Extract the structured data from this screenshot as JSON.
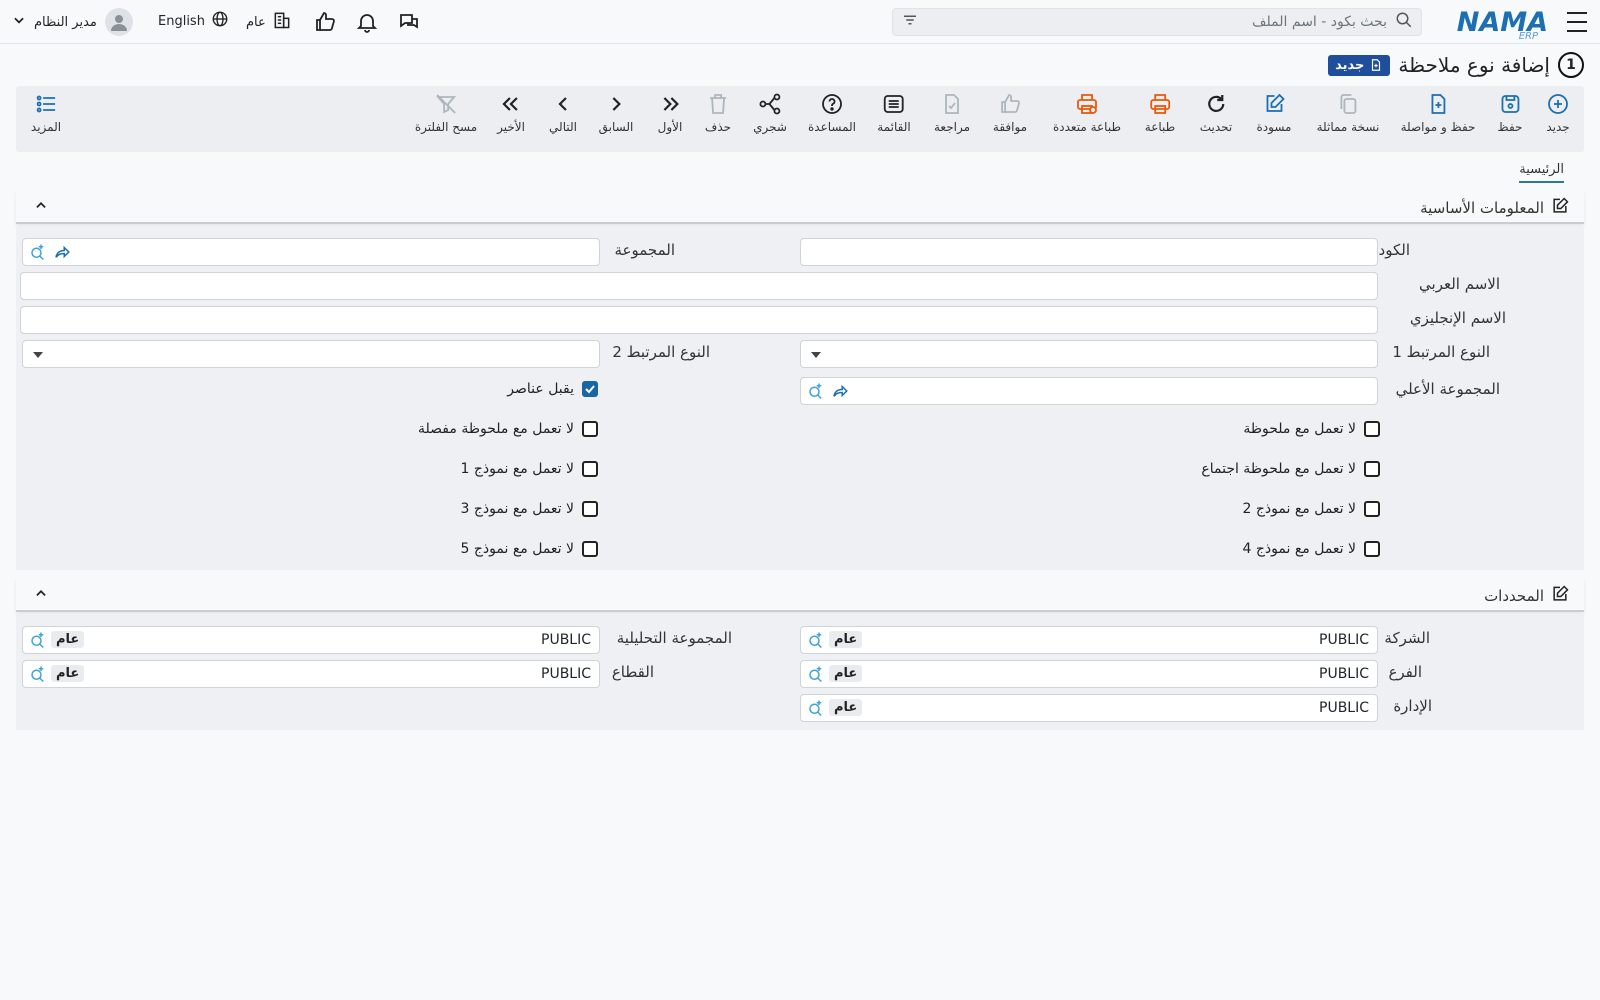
{
  "topbar": {
    "logo_text": "NAMA",
    "logo_sub": "ERP",
    "search_placeholder": "بحث بكود - اسم الملف",
    "company_label": "عام",
    "language_label": "English",
    "user_name": "مدير النظام"
  },
  "title": {
    "number": "1",
    "text": "إضافة نوع ملاحظة",
    "badge": "جديد"
  },
  "toolbar": {
    "new": "جديد",
    "save": "حفظ",
    "save_continue": "حفظ و مواصلة",
    "duplicate": "نسخة مماثلة",
    "draft": "مسودة",
    "refresh": "تحديث",
    "print": "طباعة",
    "multi_print": "طباعة متعددة",
    "approve": "موافقة",
    "review": "مراجعة",
    "list": "القائمة",
    "help": "المساعدة",
    "tree": "شجري",
    "delete": "حذف",
    "first": "الأول",
    "previous": "السابق",
    "next": "التالي",
    "last": "الأخير",
    "clear_filter": "مسح الفلترة",
    "more": "المزيد"
  },
  "tabs": {
    "main": "الرئيسية"
  },
  "basic": {
    "title": "المعلومات الأساسية",
    "code_label": "الكود",
    "group_label": "المجموعة",
    "arabic_name_label": "الاسم العربي",
    "english_name_label": "الاسم الإنجليزي",
    "related1_label": "النوع المرتبط 1",
    "related2_label": "النوع المرتبط 2",
    "parent_group_label": "المجموعة الأعلي",
    "accepts_items": "يقبل عناصر",
    "checkboxes": {
      "not_with_note": "لا تعمل مع ملحوظة",
      "not_with_detailed_note": "لا تعمل مع ملحوظة مفصلة",
      "not_with_meeting_note": "لا تعمل مع ملحوظة اجتماع",
      "not_with_form1": "لا تعمل مع نموذج 1",
      "not_with_form2": "لا تعمل مع نموذج 2",
      "not_with_form3": "لا تعمل مع نموذج 3",
      "not_with_form4": "لا تعمل مع نموذج 4",
      "not_with_form5": "لا تعمل مع نموذج 5"
    }
  },
  "dimensions": {
    "title": "المحددات",
    "company_label": "الشركة",
    "analytic_group_label": "المجموعة التحليلية",
    "branch_label": "الفرع",
    "sector_label": "القطاع",
    "department_label": "الإدارة",
    "value": "PUBLIC",
    "tag": "عام"
  },
  "colors": {
    "accent": "#1c6fb3",
    "orange": "#e8590c",
    "badge": "#1f4e9c",
    "lookup": "#3fa3d8"
  }
}
